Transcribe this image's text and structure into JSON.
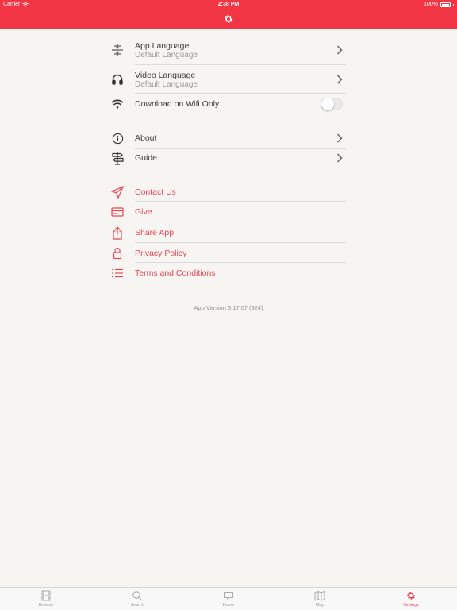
{
  "status_bar": {
    "carrier": "Carrier",
    "time": "2:38 PM",
    "battery": "100%"
  },
  "nav": {
    "icon": "gear-icon"
  },
  "sections": {
    "preferences": [
      {
        "title": "App Language",
        "subtitle": "Default Language",
        "icon": "language-icon"
      },
      {
        "title": "Video Language",
        "subtitle": "Default Language",
        "icon": "headphones-icon"
      },
      {
        "title": "Download on Wifi Only",
        "icon": "wifi-icon",
        "toggle": false
      }
    ],
    "info": [
      {
        "title": "About",
        "icon": "info-icon"
      },
      {
        "title": "Guide",
        "icon": "signpost-icon"
      }
    ],
    "actions": [
      {
        "title": "Contact Us",
        "icon": "send-icon"
      },
      {
        "title": "Give",
        "icon": "credit-card-icon"
      },
      {
        "title": "Share App",
        "icon": "share-icon"
      },
      {
        "title": "Privacy Policy",
        "icon": "lock-icon"
      },
      {
        "title": "Terms and Conditions",
        "icon": "list-icon"
      }
    ]
  },
  "version": "App Version 3.17.07 (924)",
  "tabs": [
    {
      "label": "Browse",
      "icon": "film-icon",
      "active": false
    },
    {
      "label": "Search",
      "icon": "search-icon",
      "active": false
    },
    {
      "label": "Home",
      "icon": "home-icon",
      "active": false
    },
    {
      "label": "Map",
      "icon": "map-icon",
      "active": false
    },
    {
      "label": "Settings",
      "icon": "gear-icon",
      "active": true
    }
  ],
  "colors": {
    "accent": "#f23545",
    "link": "#e8475a",
    "background": "#f6f5f1"
  }
}
